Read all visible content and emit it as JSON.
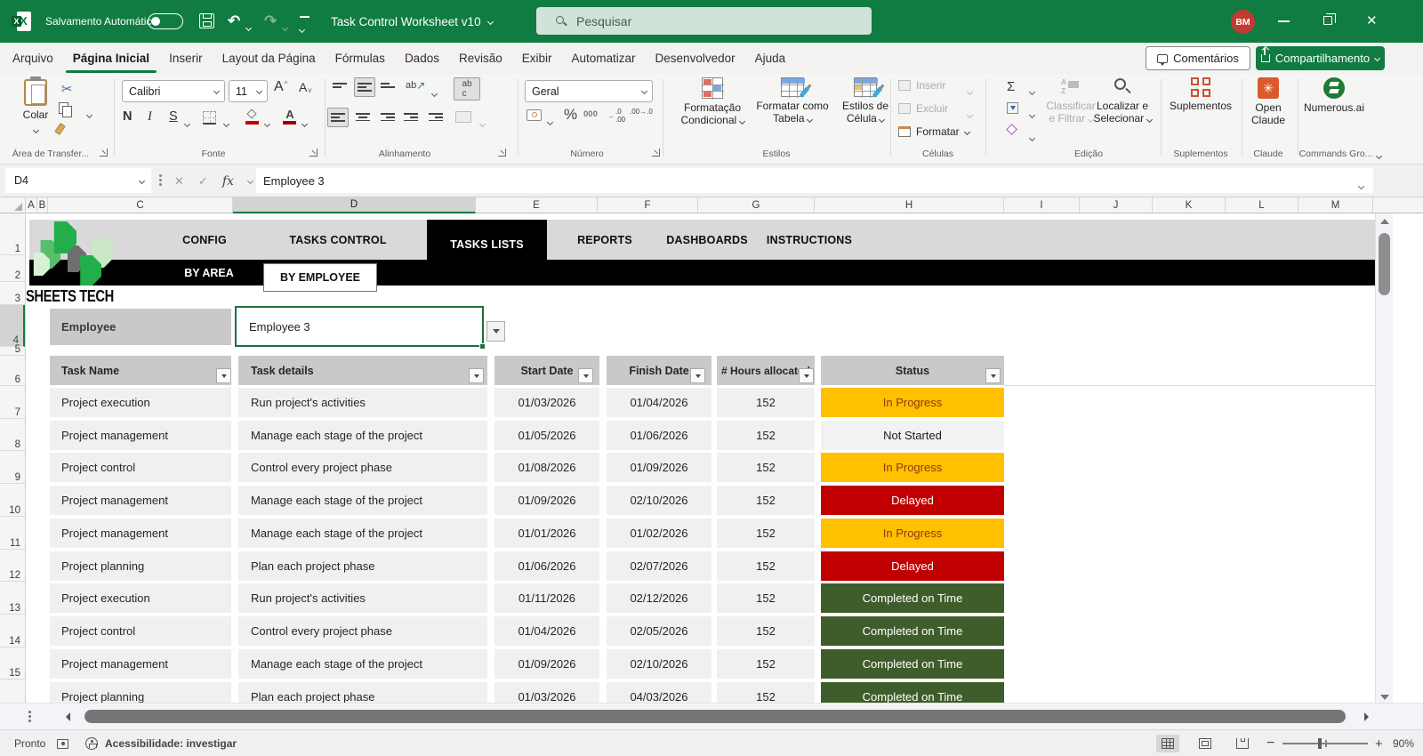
{
  "titlebar": {
    "autosave_label": "Salvamento Automático",
    "doc_title": "Task Control Worksheet v10",
    "search_placeholder": "Pesquisar",
    "avatar_initials": "BM"
  },
  "menu": {
    "items": [
      "Arquivo",
      "Página Inicial",
      "Inserir",
      "Layout da Página",
      "Fórmulas",
      "Dados",
      "Revisão",
      "Exibir",
      "Automatizar",
      "Desenvolvedor",
      "Ajuda"
    ],
    "active_item": "Página Inicial",
    "comments_label": "Comentários",
    "share_label": "Compartilhamento"
  },
  "ribbon": {
    "clipboard": {
      "paste": "Colar",
      "group": "Área de Transfer..."
    },
    "font": {
      "name": "Calibri",
      "size": "11",
      "bold": "N",
      "italic": "I",
      "underline": "S",
      "group": "Fonte"
    },
    "alignment": {
      "group": "Alinhamento"
    },
    "number": {
      "format": "Geral",
      "zeros": "000",
      "percent": "%",
      "group": "Número"
    },
    "styles": {
      "conditional_1": "Formatação",
      "conditional_2": "Condicional",
      "table_1": "Formatar como",
      "table_2": "Tabela",
      "cellstyles_1": "Estilos de",
      "cellstyles_2": "Célula",
      "group": "Estilos"
    },
    "cells": {
      "insert": "Inserir",
      "delete": "Excluir",
      "format": "Formatar",
      "group": "Células"
    },
    "editing": {
      "sort_1": "Classificar",
      "sort_2": "e Filtrar",
      "find_1": "Localizar e",
      "find_2": "Selecionar",
      "sigma": "Σ",
      "group": "Edição"
    },
    "addins": {
      "label": "Suplementos",
      "group": "Suplementos"
    },
    "claude": {
      "label_1": "Open",
      "label_2": "Claude",
      "group": "Claude"
    },
    "numerous": {
      "label": "Numerous.ai",
      "group": "Commands Gro..."
    }
  },
  "formula_bar": {
    "name_box": "D4",
    "fx": "fx",
    "content": "Employee 3"
  },
  "grid": {
    "columns": [
      "A",
      "B",
      "C",
      "D",
      "E",
      "F",
      "G",
      "H",
      "I",
      "J",
      "K",
      "L",
      "M"
    ],
    "selected_column": "D",
    "rows": [
      "1",
      "2",
      "3",
      "4",
      "5",
      "6",
      "7",
      "8",
      "9",
      "10",
      "11",
      "12",
      "13",
      "14",
      "15"
    ],
    "selected_row": "4"
  },
  "sheet": {
    "brand": "SHEETS TECH",
    "tabs": [
      "CONFIG",
      "TASKS CONTROL",
      "TASKS LISTS",
      "REPORTS",
      "DASHBOARDS",
      "INSTRUCTIONS"
    ],
    "active_tab": "TASKS LISTS",
    "subtabs": [
      "BY AREA",
      "BY EMPLOYEE"
    ],
    "active_subtab": "BY EMPLOYEE",
    "employee_label": "Employee",
    "employee_value": "Employee 3"
  },
  "table": {
    "headers": [
      "Task Name",
      "Task details",
      "Start Date",
      "Finish Date",
      "# Hours allocated",
      "Status"
    ],
    "status_colors": {
      "in_progress": {
        "bg": "#FFC000",
        "fg": "#8B3A0B"
      },
      "not_started": {
        "bg": "#F2F2F2",
        "fg": "#1A1A1A"
      },
      "delayed": {
        "bg": "#C00000",
        "fg": "#FFFFFF"
      },
      "completed_on_time": {
        "bg": "#3F5D2B",
        "fg": "#FFFFFF"
      }
    },
    "rows": [
      {
        "name": "Project execution",
        "details": "Run project's activities",
        "start": "01/03/2026",
        "finish": "01/04/2026",
        "hours": "152",
        "status": "In Progress",
        "status_key": "inprogress"
      },
      {
        "name": "Project management",
        "details": "Manage each stage of the project",
        "start": "01/05/2026",
        "finish": "01/06/2026",
        "hours": "152",
        "status": "Not Started",
        "status_key": "notstarted"
      },
      {
        "name": "Project control",
        "details": "Control every project phase",
        "start": "01/08/2026",
        "finish": "01/09/2026",
        "hours": "152",
        "status": "In Progress",
        "status_key": "inprogress"
      },
      {
        "name": "Project management",
        "details": "Manage each stage of the project",
        "start": "01/09/2026",
        "finish": "02/10/2026",
        "hours": "152",
        "status": "Delayed",
        "status_key": "delayed"
      },
      {
        "name": "Project management",
        "details": "Manage each stage of the project",
        "start": "01/01/2026",
        "finish": "01/02/2026",
        "hours": "152",
        "status": "In Progress",
        "status_key": "inprogress"
      },
      {
        "name": "Project planning",
        "details": "Plan each project phase",
        "start": "01/06/2026",
        "finish": "02/07/2026",
        "hours": "152",
        "status": "Delayed",
        "status_key": "delayed"
      },
      {
        "name": "Project execution",
        "details": "Run project's activities",
        "start": "01/11/2026",
        "finish": "02/12/2026",
        "hours": "152",
        "status": "Completed on Time",
        "status_key": "completed"
      },
      {
        "name": "Project control",
        "details": "Control every project phase",
        "start": "01/04/2026",
        "finish": "02/05/2026",
        "hours": "152",
        "status": "Completed on Time",
        "status_key": "completed"
      },
      {
        "name": "Project management",
        "details": "Manage each stage of the project",
        "start": "01/09/2026",
        "finish": "02/10/2026",
        "hours": "152",
        "status": "Completed on Time",
        "status_key": "completed"
      },
      {
        "name": "Project planning",
        "details": "Plan each project phase",
        "start": "01/03/2026",
        "finish": "04/03/2026",
        "hours": "152",
        "status": "Completed on Time",
        "status_key": "completed"
      }
    ]
  },
  "statusbar": {
    "ready": "Pronto",
    "accessibility": "Acessibilidade: investigar",
    "zoom": "90%"
  }
}
